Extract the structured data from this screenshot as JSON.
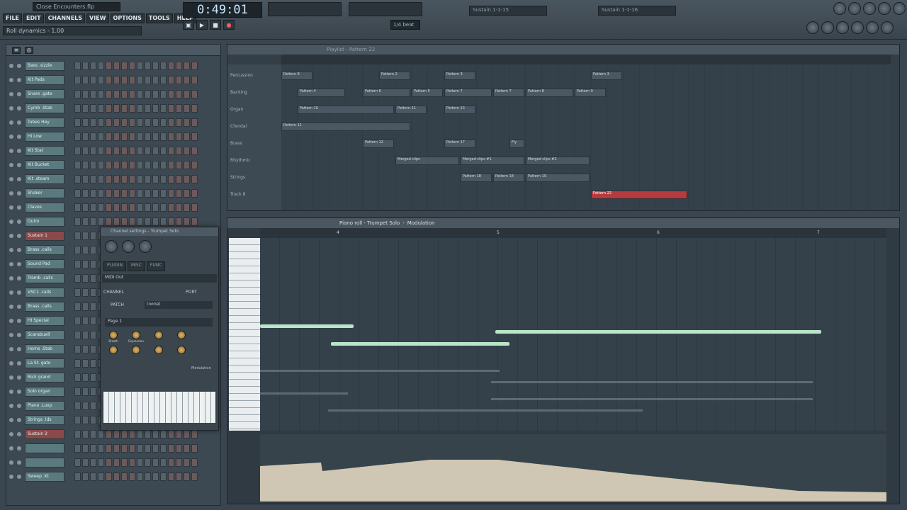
{
  "topbar": {
    "filename": "Close Encounters.flp",
    "menu": [
      "FILE",
      "EDIT",
      "CHANNELS",
      "VIEW",
      "OPTIONS",
      "TOOLS",
      "HELP"
    ],
    "hint": "Roll dynamics - 1.00",
    "time": "0:49:01",
    "tempo": "1/4 beat",
    "mixer_slot1": "Sustain 1-1-15",
    "mixer_slot2": "Sustain 1-1-16"
  },
  "channels": [
    {
      "name": "Bass .sizzle",
      "red": false
    },
    {
      "name": "Kit Pads",
      "red": false
    },
    {
      "name": "Snare .gate",
      "red": false
    },
    {
      "name": "Cymb .Stab",
      "red": false
    },
    {
      "name": "Tubes Hey",
      "red": false
    },
    {
      "name": "Hi Low",
      "red": false
    },
    {
      "name": "Kit Stat",
      "red": false
    },
    {
      "name": "Kit Bucket",
      "red": false
    },
    {
      "name": "Kit .steam",
      "red": false
    },
    {
      "name": "Shaker",
      "red": false
    },
    {
      "name": "Claves",
      "red": false
    },
    {
      "name": "Guiro",
      "red": false
    },
    {
      "name": "Sustain 1",
      "red": true
    },
    {
      "name": "Brass .calls",
      "red": false
    },
    {
      "name": "Sound Pad",
      "red": false
    },
    {
      "name": "Tromb .calls",
      "red": false
    },
    {
      "name": "VSC1 .calls",
      "red": false
    },
    {
      "name": "Brass .calls",
      "red": false
    },
    {
      "name": "HI Special",
      "red": false
    },
    {
      "name": "Scarabuell",
      "red": false
    },
    {
      "name": "Horns .Stab",
      "red": false
    },
    {
      "name": "La St. gato",
      "red": false
    },
    {
      "name": "Rick grand",
      "red": false
    },
    {
      "name": "Solo organ",
      "red": false
    },
    {
      "name": "Piano .Luxp",
      "red": false
    },
    {
      "name": "Strings .lds",
      "red": false
    },
    {
      "name": "Sustain 2",
      "red": true
    },
    {
      "name": "",
      "red": false
    },
    {
      "name": "",
      "red": false
    },
    {
      "name": "Sweep .Kt",
      "red": false
    }
  ],
  "channel_settings": {
    "title": "Channel settings - Trumpet Solo",
    "tabs": [
      "PLUGIN",
      "MISC",
      "FUNC"
    ],
    "output": "MIDI Out",
    "channel_label": "CHANNEL",
    "port_label": "PORT",
    "patch_label": "PATCH",
    "patch_value": "(none)",
    "page": "Page 1",
    "knobs": [
      "Breath",
      "Expression",
      "",
      "",
      "",
      "",
      "",
      ""
    ],
    "modulation": "Modulation"
  },
  "playlist": {
    "title": "Playlist - Pattern 22",
    "tracks": [
      "Percussion",
      "Backing",
      "Organ",
      "Chordal",
      "Brass",
      "Rhythmic",
      "Strings",
      "Track 8"
    ],
    "patterns": [
      {
        "label": "Pattern 8",
        "track": 0,
        "start": 0,
        "len": 2
      },
      {
        "label": "Pattern 2",
        "track": 0,
        "start": 6,
        "len": 2
      },
      {
        "label": "Pattern 3",
        "track": 0,
        "start": 10,
        "len": 2
      },
      {
        "label": "Pattern 3",
        "track": 0,
        "start": 19,
        "len": 2
      },
      {
        "label": "Pattern 4",
        "track": 1,
        "start": 1,
        "len": 3
      },
      {
        "label": "Pattern 6",
        "track": 1,
        "start": 5,
        "len": 3
      },
      {
        "label": "Pattern 5",
        "track": 1,
        "start": 8,
        "len": 2
      },
      {
        "label": "Pattern 7",
        "track": 1,
        "start": 10,
        "len": 3
      },
      {
        "label": "Pattern 7",
        "track": 1,
        "start": 13,
        "len": 2
      },
      {
        "label": "Pattern 8",
        "track": 1,
        "start": 15,
        "len": 3
      },
      {
        "label": "Pattern 9",
        "track": 1,
        "start": 18,
        "len": 2
      },
      {
        "label": "Pattern 10",
        "track": 2,
        "start": 1,
        "len": 6
      },
      {
        "label": "Pattern 11",
        "track": 2,
        "start": 7,
        "len": 2
      },
      {
        "label": "Pattern 13",
        "track": 2,
        "start": 10,
        "len": 2
      },
      {
        "label": "Pattern 11",
        "track": 3,
        "start": 0,
        "len": 8
      },
      {
        "label": "Pattern 12",
        "track": 4,
        "start": 5,
        "len": 2
      },
      {
        "label": "Pattern 17",
        "track": 4,
        "start": 10,
        "len": 2
      },
      {
        "label": "Fly",
        "track": 4,
        "start": 14,
        "len": 1
      },
      {
        "label": "Merged clips",
        "track": 5,
        "start": 7,
        "len": 4
      },
      {
        "label": "Merged clips #1",
        "track": 5,
        "start": 11,
        "len": 4
      },
      {
        "label": "Merged clips #2",
        "track": 5,
        "start": 15,
        "len": 4
      },
      {
        "label": "Pattern 18",
        "track": 6,
        "start": 11,
        "len": 2
      },
      {
        "label": "Pattern 18",
        "track": 6,
        "start": 13,
        "len": 2
      },
      {
        "label": "Pattern 19",
        "track": 6,
        "start": 15,
        "len": 4
      },
      {
        "label": "Pattern 22",
        "track": 7,
        "start": 19,
        "len": 6,
        "red": true
      }
    ]
  },
  "pianoroll": {
    "title": "Piano roll - Trumpet Solo",
    "mode": "Modulation",
    "bar_markers": [
      "4",
      "5",
      "6",
      "7"
    ]
  }
}
